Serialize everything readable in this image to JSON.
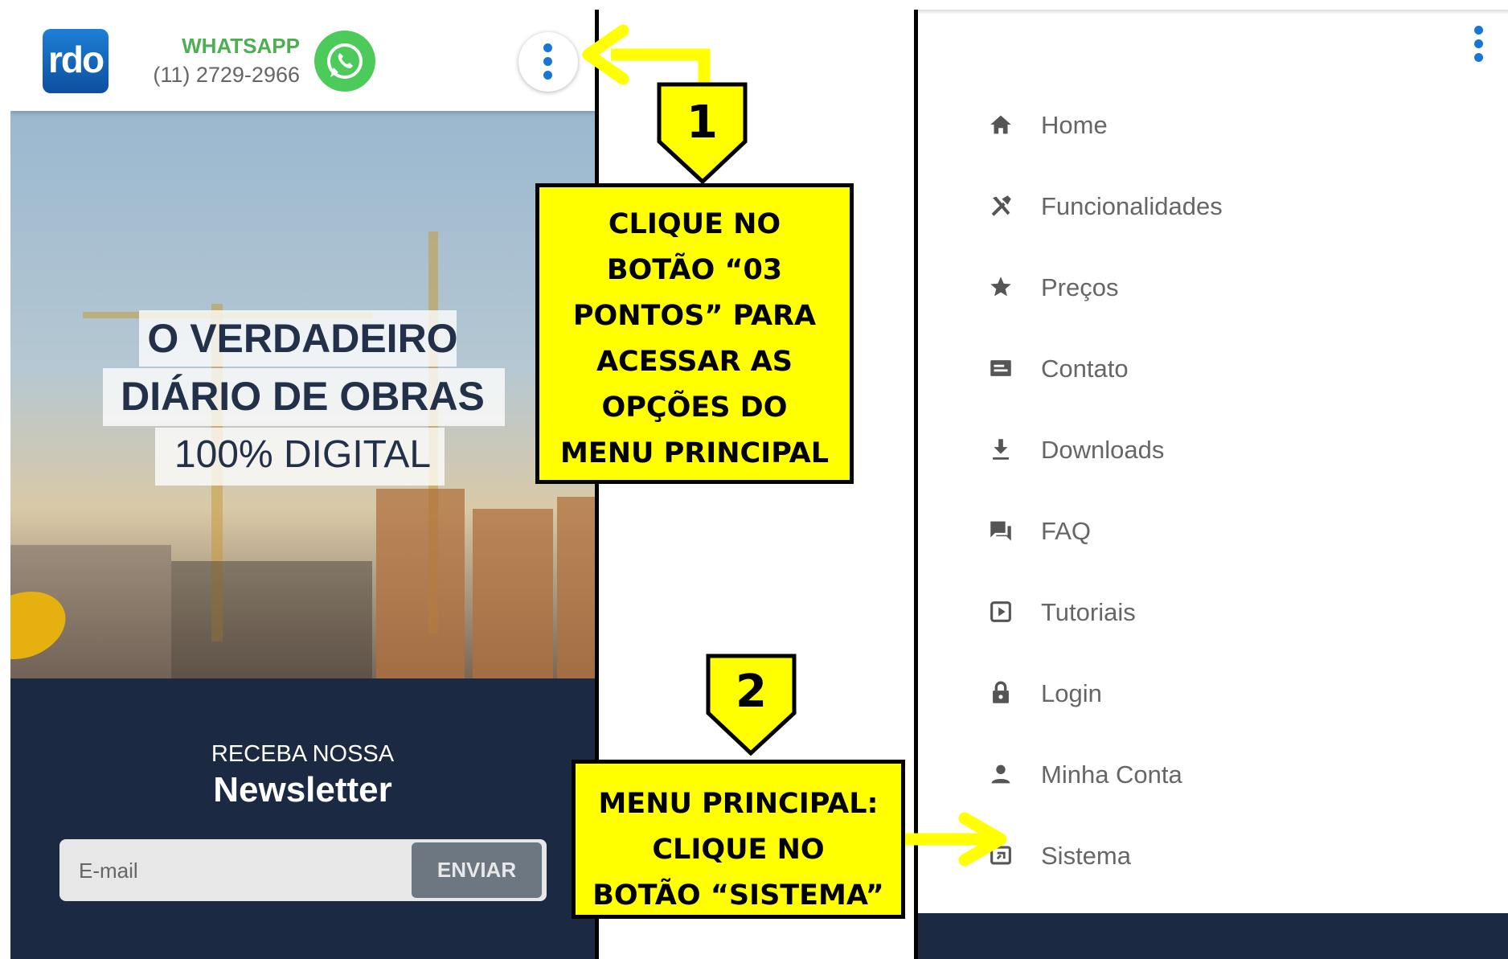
{
  "left_phone": {
    "logo_text": "rdo",
    "whatsapp_label": "WHATSAPP",
    "whatsapp_phone": "(11) 2729-2966",
    "hero": {
      "line1": "O VERDADEIRO",
      "line2": "DIÁRIO DE OBRAS",
      "line3": "100% DIGITAL"
    },
    "newsletter": {
      "small_title": "RECEBA NOSSA",
      "big_title": "Newsletter",
      "email_placeholder": "E-mail",
      "send_label": "ENVIAR"
    }
  },
  "right_phone": {
    "menu": [
      {
        "label": "Home",
        "icon": "home-icon"
      },
      {
        "label": "Funcionalidades",
        "icon": "tools-icon"
      },
      {
        "label": "Preços",
        "icon": "star-icon"
      },
      {
        "label": "Contato",
        "icon": "contact-card-icon"
      },
      {
        "label": "Downloads",
        "icon": "download-icon"
      },
      {
        "label": "FAQ",
        "icon": "forum-icon"
      },
      {
        "label": "Tutoriais",
        "icon": "play-box-icon"
      },
      {
        "label": "Login",
        "icon": "lock-icon"
      },
      {
        "label": "Minha Conta",
        "icon": "person-icon"
      },
      {
        "label": "Sistema",
        "icon": "system-window-icon"
      }
    ]
  },
  "annotations": {
    "step1_number": "1",
    "step1_lines": [
      "CLIQUE NO",
      "BOTÃO “03",
      "PONTOS” PARA",
      "ACESSAR AS",
      "OPÇÕES DO",
      "MENU PRINCIPAL"
    ],
    "step2_number": "2",
    "step2_lines": [
      "MENU PRINCIPAL:",
      "CLIQUE NO",
      "BOTÃO “SISTEMA”"
    ]
  },
  "colors": {
    "callout_fill": "#ffff00",
    "arrow": "#ffff00",
    "dark_navy": "#1b2a42",
    "accent_blue": "#1976d2",
    "whatsapp_green": "#4caf50"
  }
}
